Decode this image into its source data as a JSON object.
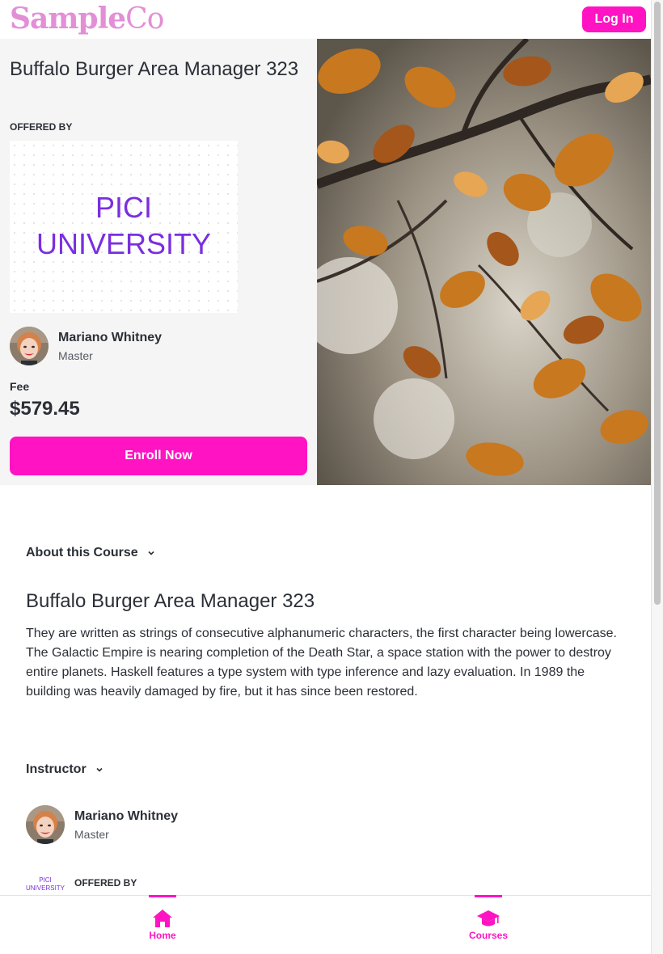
{
  "header": {
    "logo_part1": "Sample",
    "logo_part2": "Co",
    "login_label": "Log In"
  },
  "course": {
    "title": "Buffalo Burger Area Manager 323",
    "offered_by_label": "OFFERED BY",
    "university_logo_text": [
      "PICI",
      "UNIVERSITY"
    ],
    "instructor": {
      "name": "Mariano Whitney",
      "title": "Master"
    },
    "fee_label": "Fee",
    "fee_value": "$579.45",
    "enroll_label": "Enroll Now"
  },
  "about": {
    "heading": "About this Course",
    "title": "Buffalo Burger Area Manager 323",
    "description": "They are written as strings of consecutive alphanumeric characters, the first character being lowercase. The Galactic Empire is nearing completion of the Death Star, a space station with the power to destroy entire planets. Haskell features a type system with type inference and lazy evaluation. In 1989 the building was heavily damaged by fire, but it has since been restored."
  },
  "instructor_section": {
    "heading": "Instructor",
    "name": "Mariano Whitney",
    "title": "Master",
    "offered_by_label": "OFFERED BY",
    "logo_text": [
      "PICI",
      "UNIVERSITY"
    ]
  },
  "bottom_nav": {
    "items": [
      {
        "label": "Home",
        "icon": "home-icon"
      },
      {
        "label": "Courses",
        "icon": "graduation-cap-icon"
      }
    ]
  },
  "colors": {
    "accent": "#ff13c3",
    "logo": "#e38fd6",
    "university": "#7a2ee0",
    "hero_bg": "#f5f5f6"
  }
}
